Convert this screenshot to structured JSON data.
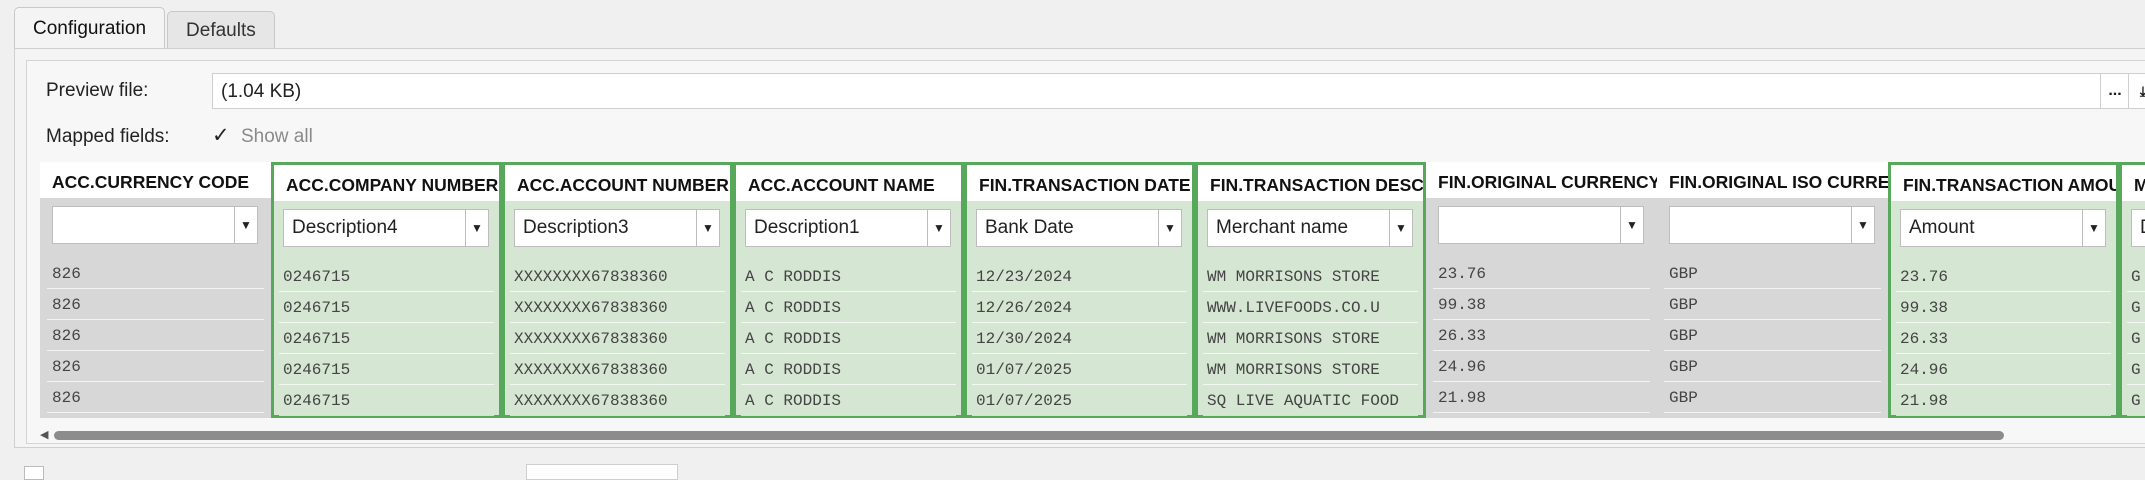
{
  "tabs": [
    {
      "label": "Configuration",
      "active": true
    },
    {
      "label": "Defaults",
      "active": false
    }
  ],
  "preview": {
    "label": "Preview file:",
    "value": "(1.04 KB)",
    "browse_label": "..."
  },
  "mapped_fields": {
    "label": "Mapped fields:",
    "show_all_label": "Show all",
    "show_all_checked": true
  },
  "colors": {
    "mapped_border": "#58a85c",
    "mapped_fill": "#d5e6d2",
    "unmapped_fill": "#d7d7d7"
  },
  "grid": {
    "columns": [
      {
        "header": "ACC.CURRENCY CODE",
        "mapping": "",
        "mapped": false,
        "cells": [
          "826",
          "826",
          "826",
          "826",
          "826"
        ]
      },
      {
        "header": "ACC.COMPANY NUMBER",
        "mapping": "Description4",
        "mapped": true,
        "cells": [
          "0246715",
          "0246715",
          "0246715",
          "0246715",
          "0246715"
        ]
      },
      {
        "header": "ACC.ACCOUNT NUMBER",
        "mapping": "Description3",
        "mapped": true,
        "cells": [
          "XXXXXXXX67838360",
          "XXXXXXXX67838360",
          "XXXXXXXX67838360",
          "XXXXXXXX67838360",
          "XXXXXXXX67838360"
        ]
      },
      {
        "header": "ACC.ACCOUNT NAME",
        "mapping": "Description1",
        "mapped": true,
        "cells": [
          "A C RODDIS",
          "A C RODDIS",
          "A C RODDIS",
          "A C RODDIS",
          "A C RODDIS"
        ]
      },
      {
        "header": "FIN.TRANSACTION DATE",
        "mapping": "Bank Date",
        "mapped": true,
        "cells": [
          "12/23/2024",
          "12/26/2024",
          "12/30/2024",
          "01/07/2025",
          "01/07/2025"
        ]
      },
      {
        "header": "FIN.TRANSACTION DESCRIPTION",
        "mapping": "Merchant name",
        "mapped": true,
        "cells": [
          "WM MORRISONS STORE",
          "WWW.LIVEFOODS.CO.U",
          "WM MORRISONS STORE",
          "WM MORRISONS STORE",
          "SQ LIVE AQUATIC FOOD"
        ]
      },
      {
        "header": "FIN.ORIGINAL CURRENCY",
        "mapping": "",
        "mapped": false,
        "cells": [
          "23.76",
          "99.38",
          "26.33",
          "24.96",
          "21.98"
        ]
      },
      {
        "header": "FIN.ORIGINAL ISO CURRENCY",
        "mapping": "",
        "mapped": false,
        "cells": [
          "GBP",
          "GBP",
          "GBP",
          "GBP",
          "GBP"
        ]
      },
      {
        "header": "FIN.TRANSACTION AMOUNT",
        "mapping": "Amount",
        "mapped": true,
        "cells": [
          "23.76",
          "99.38",
          "26.33",
          "24.96",
          "21.98"
        ]
      },
      {
        "header": "M",
        "mapping": "D",
        "mapped": true,
        "cells": [
          "G",
          "G",
          "G",
          "G",
          "G"
        ]
      }
    ]
  }
}
